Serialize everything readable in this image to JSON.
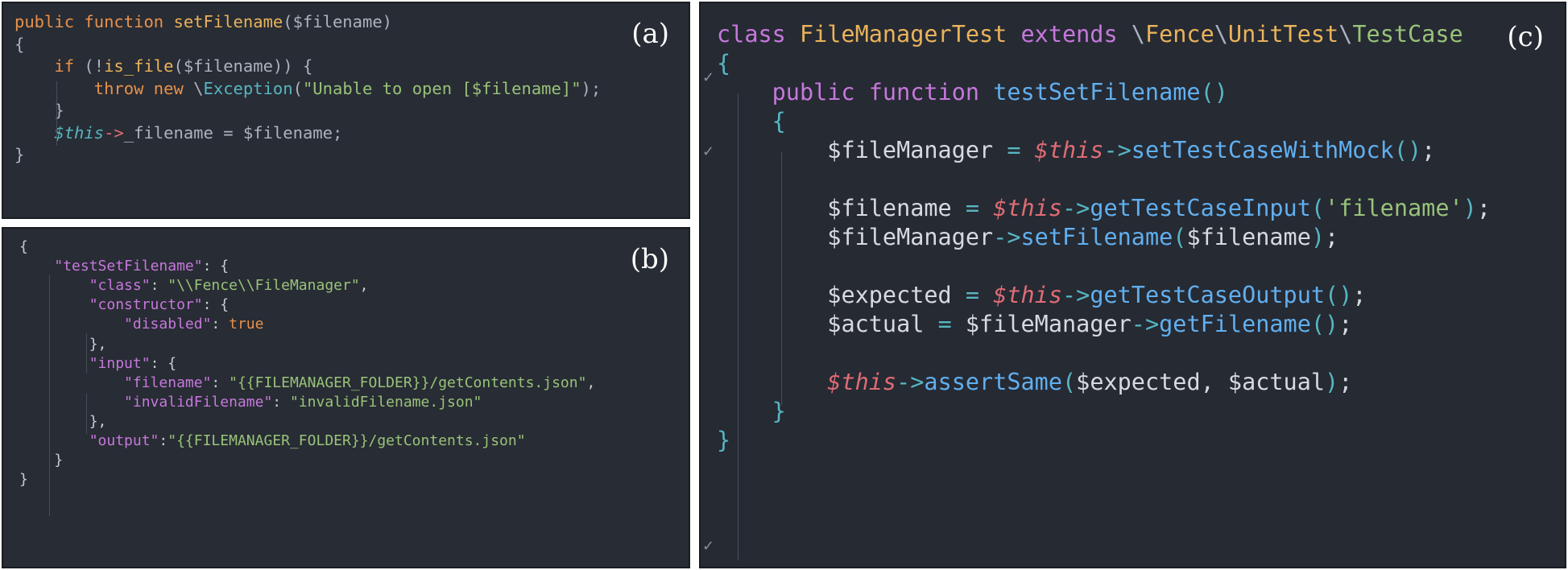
{
  "panels": {
    "a": {
      "label": "(a)",
      "lines": [
        [
          [
            "kw",
            "public function "
          ],
          [
            "fn",
            "setFilename"
          ],
          [
            "pl",
            "($filename)"
          ]
        ],
        [
          [
            "pl",
            "{"
          ]
        ],
        [
          [
            "pl",
            "    "
          ],
          [
            "kw",
            "if "
          ],
          [
            "pl",
            "(!"
          ],
          [
            "fn",
            "is_file"
          ],
          [
            "pl",
            "($filename)) {"
          ]
        ],
        [
          [
            "pl",
            "        "
          ],
          [
            "kw",
            "throw new "
          ],
          [
            "pl",
            "\\"
          ],
          [
            "cls",
            "Exception"
          ],
          [
            "pl",
            "("
          ],
          [
            "str",
            "\"Unable to open [$filename]\""
          ],
          [
            "pl",
            ");"
          ]
        ],
        [
          [
            "pl",
            "    }"
          ]
        ],
        [
          [
            "pl",
            "    "
          ],
          [
            "thi",
            "$this"
          ],
          [
            "op",
            "->"
          ],
          [
            "pl",
            "_filename = $filename;"
          ]
        ],
        [
          [
            "pl",
            "}"
          ]
        ]
      ]
    },
    "b": {
      "label": "(b)",
      "lines": [
        [
          [
            "par",
            "{"
          ]
        ],
        [
          [
            "par",
            "    "
          ],
          [
            "key",
            "\"testSetFilename\""
          ],
          [
            "par",
            ": {"
          ]
        ],
        [
          [
            "par",
            "        "
          ],
          [
            "key",
            "\"class\""
          ],
          [
            "par",
            ": "
          ],
          [
            "jstr",
            "\"\\\\Fence\\\\FileManager\""
          ],
          [
            "par",
            ","
          ]
        ],
        [
          [
            "par",
            "        "
          ],
          [
            "key",
            "\"constructor\""
          ],
          [
            "par",
            ": {"
          ]
        ],
        [
          [
            "par",
            "            "
          ],
          [
            "key",
            "\"disabled\""
          ],
          [
            "par",
            ": "
          ],
          [
            "bool",
            "true"
          ]
        ],
        [
          [
            "par",
            "        },"
          ]
        ],
        [
          [
            "par",
            "        "
          ],
          [
            "key",
            "\"input\""
          ],
          [
            "par",
            ": {"
          ]
        ],
        [
          [
            "par",
            "            "
          ],
          [
            "key",
            "\"filename\""
          ],
          [
            "par",
            ": "
          ],
          [
            "jstr",
            "\"{{FILEMANAGER_FOLDER}}/getContents.json\""
          ],
          [
            "par",
            ","
          ]
        ],
        [
          [
            "par",
            "            "
          ],
          [
            "key",
            "\"invalidFilename\""
          ],
          [
            "par",
            ": "
          ],
          [
            "jstr",
            "\"invalidFilename.json\""
          ]
        ],
        [
          [
            "par",
            "        },"
          ]
        ],
        [
          [
            "par",
            "        "
          ],
          [
            "key",
            "\"output\""
          ],
          [
            "par",
            ":"
          ],
          [
            "jstr",
            "\"{{FILEMANAGER_FOLDER}}/getContents.json\""
          ]
        ],
        [
          [
            "par",
            "    }"
          ]
        ],
        [
          [
            "par",
            "}"
          ]
        ]
      ]
    },
    "c": {
      "label": "(c)",
      "lines": [
        [
          [
            "kwp",
            "class "
          ],
          [
            "fn",
            "FileManagerTest "
          ],
          [
            "kwp",
            "extends "
          ],
          [
            "pl",
            "\\"
          ],
          [
            "fn",
            "Fence"
          ],
          [
            "pl",
            "\\"
          ],
          [
            "fn",
            "UnitTest"
          ],
          [
            "pl",
            "\\"
          ],
          [
            "str",
            "TestCase"
          ]
        ],
        [
          [
            "cls",
            "{"
          ]
        ],
        [
          [
            "pl",
            "    "
          ],
          [
            "kwp",
            "public function "
          ],
          [
            "fnb",
            "testSetFilename"
          ],
          [
            "cls",
            "()"
          ]
        ],
        [
          [
            "pl",
            "    "
          ],
          [
            "cls",
            "{"
          ]
        ],
        [
          [
            "pl",
            "        "
          ],
          [
            "var",
            "$fileManager "
          ],
          [
            "opc",
            "= "
          ],
          [
            "thr",
            "$this"
          ],
          [
            "opc",
            "->"
          ],
          [
            "fnb",
            "setTestCaseWithMock"
          ],
          [
            "cls",
            "()"
          ],
          [
            "var",
            ";"
          ]
        ],
        [],
        [
          [
            "pl",
            "        "
          ],
          [
            "var",
            "$filename "
          ],
          [
            "opc",
            "= "
          ],
          [
            "thr",
            "$this"
          ],
          [
            "opc",
            "->"
          ],
          [
            "fnb",
            "getTestCaseInput"
          ],
          [
            "cls",
            "("
          ],
          [
            "str",
            "'filename'"
          ],
          [
            "cls",
            ")"
          ],
          [
            "var",
            ";"
          ]
        ],
        [
          [
            "pl",
            "        "
          ],
          [
            "var",
            "$fileManager"
          ],
          [
            "opc",
            "->"
          ],
          [
            "fnb",
            "setFilename"
          ],
          [
            "cls",
            "("
          ],
          [
            "var",
            "$filename"
          ],
          [
            "cls",
            ")"
          ],
          [
            "var",
            ";"
          ]
        ],
        [],
        [
          [
            "pl",
            "        "
          ],
          [
            "var",
            "$expected "
          ],
          [
            "opc",
            "= "
          ],
          [
            "thr",
            "$this"
          ],
          [
            "opc",
            "->"
          ],
          [
            "fnb",
            "getTestCaseOutput"
          ],
          [
            "cls",
            "()"
          ],
          [
            "var",
            ";"
          ]
        ],
        [
          [
            "pl",
            "        "
          ],
          [
            "var",
            "$actual "
          ],
          [
            "opc",
            "= "
          ],
          [
            "var",
            "$fileManager"
          ],
          [
            "opc",
            "->"
          ],
          [
            "fnb",
            "getFilename"
          ],
          [
            "cls",
            "()"
          ],
          [
            "var",
            ";"
          ]
        ],
        [],
        [
          [
            "pl",
            "        "
          ],
          [
            "thr",
            "$this"
          ],
          [
            "opc",
            "->"
          ],
          [
            "fnb",
            "assertSame"
          ],
          [
            "cls",
            "("
          ],
          [
            "var",
            "$expected, $actual"
          ],
          [
            "cls",
            ")"
          ],
          [
            "var",
            ";"
          ]
        ],
        [
          [
            "pl",
            "    "
          ],
          [
            "cls",
            "}"
          ]
        ],
        [
          [
            "cls",
            "}"
          ]
        ]
      ]
    }
  },
  "gutter_marks": [
    "✓",
    "✓",
    "✓"
  ],
  "colors": {
    "panel_bg": "#282c34",
    "keyword_orange": "#e8914b",
    "keyword_purple": "#c678dd",
    "function_yellow": "#eab35a",
    "function_blue": "#61afef",
    "string_green": "#98c379",
    "cyan": "#56b6c2",
    "this_red": "#e06c75"
  }
}
